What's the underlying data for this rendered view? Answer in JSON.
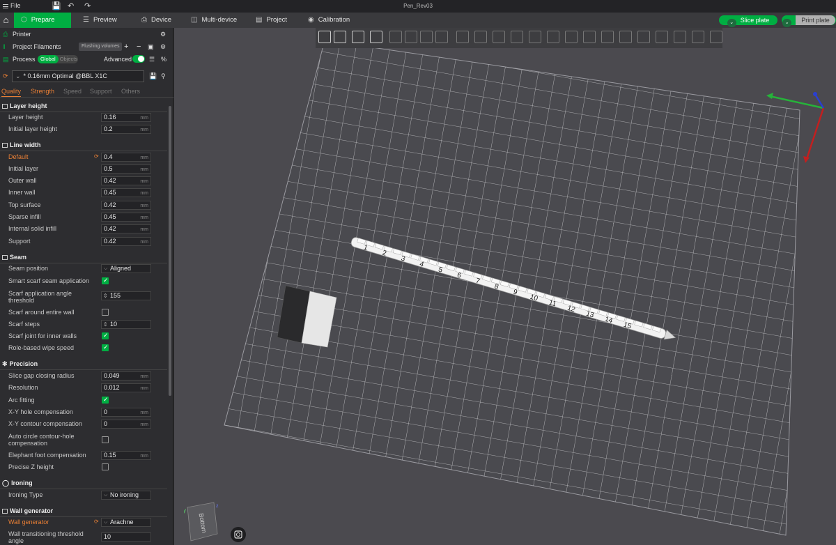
{
  "window": {
    "title": "Pen_Rev03",
    "file_menu": "File"
  },
  "topbar": {
    "tabs": [
      {
        "label": "Prepare",
        "icon": "cube-icon"
      },
      {
        "label": "Preview",
        "icon": "layers-icon"
      },
      {
        "label": "Device",
        "icon": "printer-icon"
      },
      {
        "label": "Multi-device",
        "icon": "multi-device-icon"
      },
      {
        "label": "Project",
        "icon": "project-icon"
      },
      {
        "label": "Calibration",
        "icon": "calibration-icon"
      }
    ],
    "slice_label": "Slice plate",
    "print_label": "Print plate"
  },
  "sidebar": {
    "printer": "Printer",
    "project_filaments": "Project Filaments",
    "flushing_volumes": "Flushing volumes",
    "process": "Process",
    "global": "Global",
    "objects": "Objects",
    "advanced": "Advanced",
    "preset": "* 0.16mm Optimal @BBL X1C",
    "subtabs": [
      "Quality",
      "Strength",
      "Speed",
      "Support",
      "Others"
    ]
  },
  "quality": {
    "layer_height": {
      "title": "Layer height",
      "rows": [
        {
          "name": "Layer height",
          "value": "0.16",
          "unit": "mm"
        },
        {
          "name": "Initial layer height",
          "value": "0.2",
          "unit": "mm"
        }
      ]
    },
    "line_width": {
      "title": "Line width",
      "rows": [
        {
          "name": "Default",
          "value": "0.4",
          "unit": "mm"
        },
        {
          "name": "Initial layer",
          "value": "0.5",
          "unit": "mm"
        },
        {
          "name": "Outer wall",
          "value": "0.42",
          "unit": "mm"
        },
        {
          "name": "Inner wall",
          "value": "0.45",
          "unit": "mm"
        },
        {
          "name": "Top surface",
          "value": "0.42",
          "unit": "mm"
        },
        {
          "name": "Sparse infill",
          "value": "0.45",
          "unit": "mm"
        },
        {
          "name": "Internal solid infill",
          "value": "0.42",
          "unit": "mm"
        },
        {
          "name": "Support",
          "value": "0.42",
          "unit": "mm"
        }
      ]
    },
    "seam": {
      "title": "Seam",
      "seam_position": {
        "name": "Seam position",
        "value": "Aligned"
      },
      "smart_scarf": {
        "name": "Smart scarf seam application",
        "checked": true
      },
      "scarf_threshold": {
        "name": "Scarf application angle threshold",
        "value": "155"
      },
      "scarf_entire": {
        "name": "Scarf around entire wall",
        "checked": false
      },
      "scarf_steps": {
        "name": "Scarf steps",
        "value": "10"
      },
      "scarf_inner": {
        "name": "Scarf joint for inner walls",
        "checked": true
      },
      "role_wipe": {
        "name": "Role-based wipe speed",
        "checked": true
      }
    },
    "precision": {
      "title": "Precision",
      "slice_gap": {
        "name": "Slice gap closing radius",
        "value": "0.049",
        "unit": "mm"
      },
      "resolution": {
        "name": "Resolution",
        "value": "0.012",
        "unit": "mm"
      },
      "arc_fitting": {
        "name": "Arc fitting",
        "checked": true
      },
      "xy_hole": {
        "name": "X-Y hole compensation",
        "value": "0",
        "unit": "mm"
      },
      "xy_contour": {
        "name": "X-Y contour compensation",
        "value": "0",
        "unit": "mm"
      },
      "auto_circle": {
        "name": "Auto circle contour-hole compensation",
        "checked": false
      },
      "elephant": {
        "name": "Elephant foot compensation",
        "value": "0.15",
        "unit": "mm"
      },
      "precise_z": {
        "name": "Precise Z height",
        "checked": false
      }
    },
    "ironing": {
      "title": "Ironing",
      "type": {
        "name": "Ironing Type",
        "value": "No ironing"
      }
    },
    "wall_generator": {
      "title": "Wall generator",
      "generator": {
        "name": "Wall generator",
        "value": "Arachne"
      },
      "threshold": {
        "name": "Wall transitioning threshold angle",
        "value": "10"
      }
    }
  },
  "model": {
    "ruler_numbers": [
      "1",
      "2",
      "3",
      "4",
      "5",
      "6",
      "7",
      "8",
      "9",
      "10",
      "11",
      "12",
      "13",
      "14",
      "15"
    ]
  },
  "navcube": {
    "face": "Bottom",
    "axis_y": "y",
    "axis_z": "z"
  },
  "colors": {
    "accent": "#00ae42",
    "modified": "#e87f35",
    "panel": "#2d2d30",
    "viewport": "#4b4a4f"
  }
}
